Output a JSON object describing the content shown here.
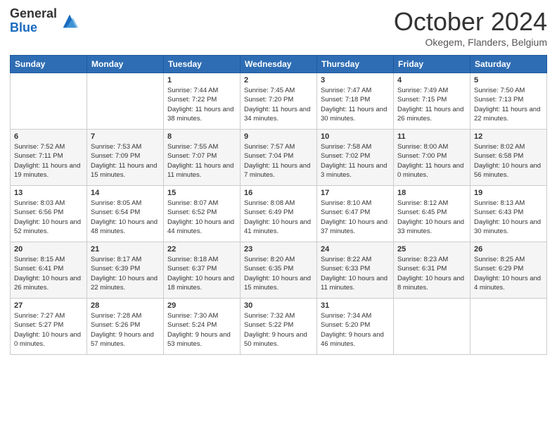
{
  "logo": {
    "general": "General",
    "blue": "Blue"
  },
  "header": {
    "month": "October 2024",
    "location": "Okegem, Flanders, Belgium"
  },
  "days_of_week": [
    "Sunday",
    "Monday",
    "Tuesday",
    "Wednesday",
    "Thursday",
    "Friday",
    "Saturday"
  ],
  "weeks": [
    [
      {
        "day": "",
        "info": ""
      },
      {
        "day": "",
        "info": ""
      },
      {
        "day": "1",
        "info": "Sunrise: 7:44 AM\nSunset: 7:22 PM\nDaylight: 11 hours and 38 minutes."
      },
      {
        "day": "2",
        "info": "Sunrise: 7:45 AM\nSunset: 7:20 PM\nDaylight: 11 hours and 34 minutes."
      },
      {
        "day": "3",
        "info": "Sunrise: 7:47 AM\nSunset: 7:18 PM\nDaylight: 11 hours and 30 minutes."
      },
      {
        "day": "4",
        "info": "Sunrise: 7:49 AM\nSunset: 7:15 PM\nDaylight: 11 hours and 26 minutes."
      },
      {
        "day": "5",
        "info": "Sunrise: 7:50 AM\nSunset: 7:13 PM\nDaylight: 11 hours and 22 minutes."
      }
    ],
    [
      {
        "day": "6",
        "info": "Sunrise: 7:52 AM\nSunset: 7:11 PM\nDaylight: 11 hours and 19 minutes."
      },
      {
        "day": "7",
        "info": "Sunrise: 7:53 AM\nSunset: 7:09 PM\nDaylight: 11 hours and 15 minutes."
      },
      {
        "day": "8",
        "info": "Sunrise: 7:55 AM\nSunset: 7:07 PM\nDaylight: 11 hours and 11 minutes."
      },
      {
        "day": "9",
        "info": "Sunrise: 7:57 AM\nSunset: 7:04 PM\nDaylight: 11 hours and 7 minutes."
      },
      {
        "day": "10",
        "info": "Sunrise: 7:58 AM\nSunset: 7:02 PM\nDaylight: 11 hours and 3 minutes."
      },
      {
        "day": "11",
        "info": "Sunrise: 8:00 AM\nSunset: 7:00 PM\nDaylight: 11 hours and 0 minutes."
      },
      {
        "day": "12",
        "info": "Sunrise: 8:02 AM\nSunset: 6:58 PM\nDaylight: 10 hours and 56 minutes."
      }
    ],
    [
      {
        "day": "13",
        "info": "Sunrise: 8:03 AM\nSunset: 6:56 PM\nDaylight: 10 hours and 52 minutes."
      },
      {
        "day": "14",
        "info": "Sunrise: 8:05 AM\nSunset: 6:54 PM\nDaylight: 10 hours and 48 minutes."
      },
      {
        "day": "15",
        "info": "Sunrise: 8:07 AM\nSunset: 6:52 PM\nDaylight: 10 hours and 44 minutes."
      },
      {
        "day": "16",
        "info": "Sunrise: 8:08 AM\nSunset: 6:49 PM\nDaylight: 10 hours and 41 minutes."
      },
      {
        "day": "17",
        "info": "Sunrise: 8:10 AM\nSunset: 6:47 PM\nDaylight: 10 hours and 37 minutes."
      },
      {
        "day": "18",
        "info": "Sunrise: 8:12 AM\nSunset: 6:45 PM\nDaylight: 10 hours and 33 minutes."
      },
      {
        "day": "19",
        "info": "Sunrise: 8:13 AM\nSunset: 6:43 PM\nDaylight: 10 hours and 30 minutes."
      }
    ],
    [
      {
        "day": "20",
        "info": "Sunrise: 8:15 AM\nSunset: 6:41 PM\nDaylight: 10 hours and 26 minutes."
      },
      {
        "day": "21",
        "info": "Sunrise: 8:17 AM\nSunset: 6:39 PM\nDaylight: 10 hours and 22 minutes."
      },
      {
        "day": "22",
        "info": "Sunrise: 8:18 AM\nSunset: 6:37 PM\nDaylight: 10 hours and 18 minutes."
      },
      {
        "day": "23",
        "info": "Sunrise: 8:20 AM\nSunset: 6:35 PM\nDaylight: 10 hours and 15 minutes."
      },
      {
        "day": "24",
        "info": "Sunrise: 8:22 AM\nSunset: 6:33 PM\nDaylight: 10 hours and 11 minutes."
      },
      {
        "day": "25",
        "info": "Sunrise: 8:23 AM\nSunset: 6:31 PM\nDaylight: 10 hours and 8 minutes."
      },
      {
        "day": "26",
        "info": "Sunrise: 8:25 AM\nSunset: 6:29 PM\nDaylight: 10 hours and 4 minutes."
      }
    ],
    [
      {
        "day": "27",
        "info": "Sunrise: 7:27 AM\nSunset: 5:27 PM\nDaylight: 10 hours and 0 minutes."
      },
      {
        "day": "28",
        "info": "Sunrise: 7:28 AM\nSunset: 5:26 PM\nDaylight: 9 hours and 57 minutes."
      },
      {
        "day": "29",
        "info": "Sunrise: 7:30 AM\nSunset: 5:24 PM\nDaylight: 9 hours and 53 minutes."
      },
      {
        "day": "30",
        "info": "Sunrise: 7:32 AM\nSunset: 5:22 PM\nDaylight: 9 hours and 50 minutes."
      },
      {
        "day": "31",
        "info": "Sunrise: 7:34 AM\nSunset: 5:20 PM\nDaylight: 9 hours and 46 minutes."
      },
      {
        "day": "",
        "info": ""
      },
      {
        "day": "",
        "info": ""
      }
    ]
  ]
}
